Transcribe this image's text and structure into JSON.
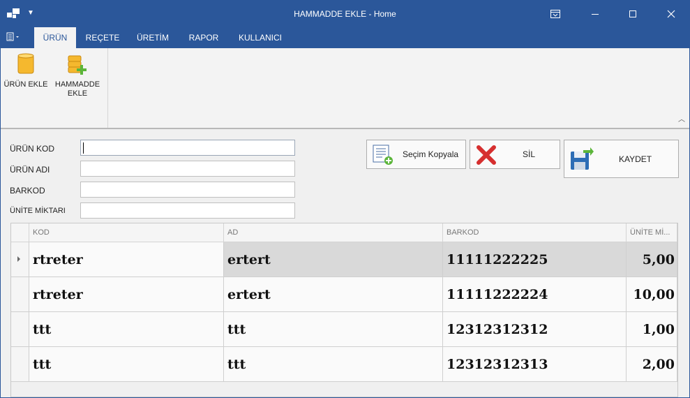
{
  "window": {
    "title": "HAMMADDE EKLE - Home",
    "accent_color": "#2b579a"
  },
  "ribbon": {
    "tabs": [
      {
        "label": "ÜRÜN",
        "active": true
      },
      {
        "label": "REÇETE",
        "active": false
      },
      {
        "label": "ÜRETİM",
        "active": false
      },
      {
        "label": "RAPOR",
        "active": false
      },
      {
        "label": "KULLANICI",
        "active": false
      }
    ],
    "buttons": [
      {
        "label": "ÜRÜN EKLE",
        "icon": "database-icon"
      },
      {
        "label": "HAMMADDE EKLE",
        "icon": "database-add-icon"
      }
    ]
  },
  "form": {
    "fields": [
      {
        "label": "ÜRÜN KOD",
        "value": ""
      },
      {
        "label": "ÜRÜN ADI",
        "value": ""
      },
      {
        "label": "BARKOD",
        "value": ""
      },
      {
        "label": "ÜNİTE MİKTARI",
        "value": ""
      }
    ],
    "buttons": {
      "copy": {
        "label": "Seçim Kopyala",
        "icon": "copy-selection-icon"
      },
      "delete": {
        "label": "SİL",
        "icon": "delete-x-icon"
      },
      "save": {
        "label": "KAYDET",
        "icon": "save-icon"
      }
    }
  },
  "grid": {
    "columns": [
      "KOD",
      "AD",
      "BARKOD",
      "ÜNİTE Mİ..."
    ],
    "rows": [
      {
        "kod": "rtreter",
        "ad": "ertert",
        "barkod": "11111222225",
        "unite": "5,00",
        "selected": true
      },
      {
        "kod": "rtreter",
        "ad": "ertert",
        "barkod": "11111222224",
        "unite": "10,00",
        "selected": false
      },
      {
        "kod": "ttt",
        "ad": "ttt",
        "barkod": "12312312312",
        "unite": "1,00",
        "selected": false
      },
      {
        "kod": "ttt",
        "ad": "ttt",
        "barkod": "12312312313",
        "unite": "2,00",
        "selected": false
      }
    ]
  }
}
